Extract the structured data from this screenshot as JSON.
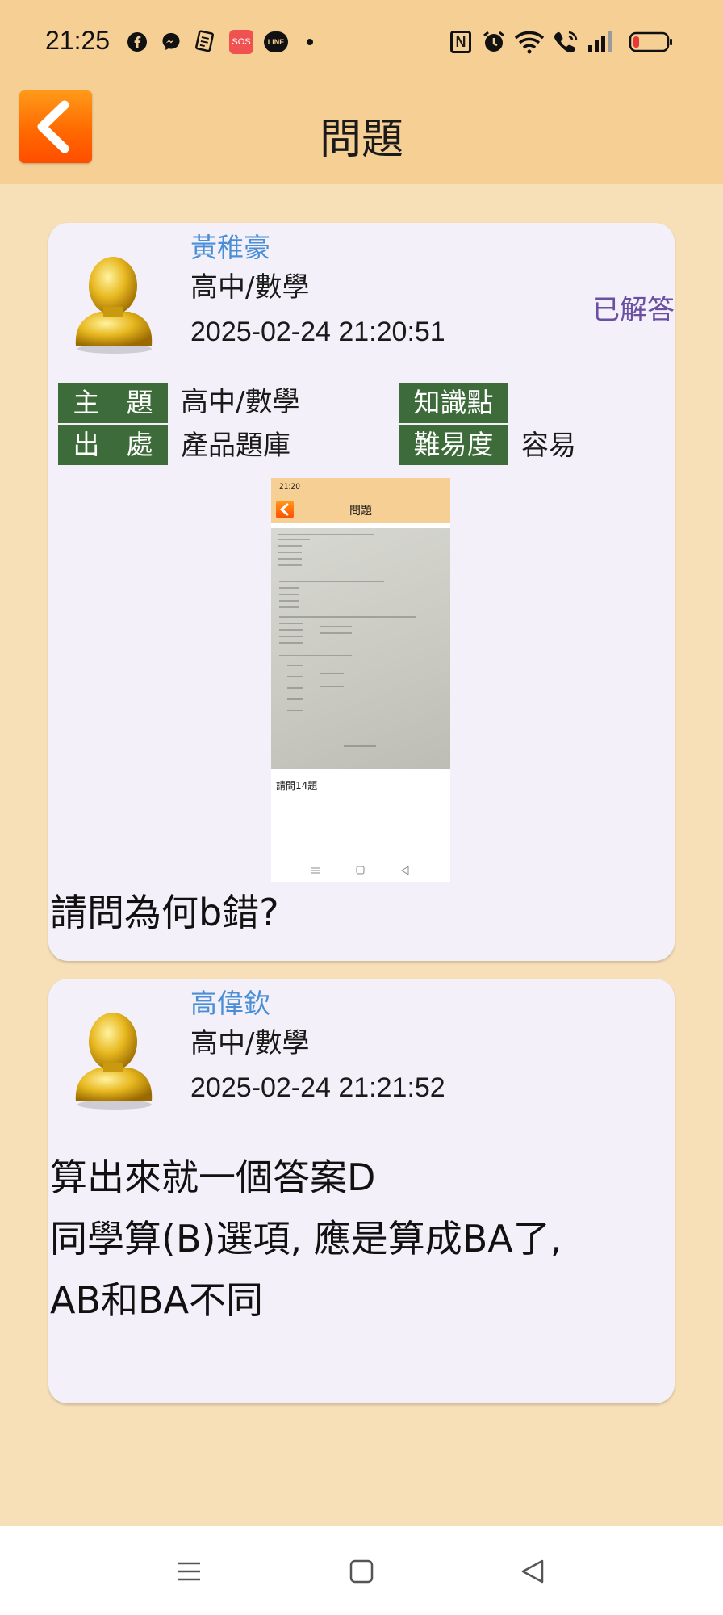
{
  "status_bar": {
    "time": "21:25",
    "icons": [
      "facebook-icon",
      "messenger-icon",
      "notes-app-icon",
      "sos-icon",
      "line-icon",
      "dot-icon",
      "nfc-icon",
      "alarm-icon",
      "wifi-icon",
      "wifi-call-icon",
      "signal-icon",
      "battery-low-icon"
    ],
    "sos_label": "SOS",
    "line_label": "LINE",
    "nfc_label": "N"
  },
  "header": {
    "title": "問題",
    "back_icon": "chevron-left-icon"
  },
  "question": {
    "user_name": "黃稚豪",
    "category": "高中/數學",
    "timestamp": "2025-02-24 21:20:51",
    "status": "已解答",
    "fields": {
      "topic_label": "主　題",
      "topic_value": "高中/數學",
      "knowledge_label": "知識點",
      "knowledge_value": "",
      "source_label": "出　處",
      "source_value": "產品題庫",
      "difficulty_label": "難易度",
      "difficulty_value": "容易"
    },
    "attachment": {
      "title": "問題",
      "time": "21:20",
      "caption": "請問14題"
    },
    "text": "請問為何b錯?"
  },
  "answer": {
    "user_name": "高偉欽",
    "category": "高中/數學",
    "timestamp": "2025-02-24 21:21:52",
    "text": "算出來就一個答案D\n同學算(B)選項, 應是算成BA了,\nAB和BA不同"
  },
  "nav_bar": {
    "icons": [
      "menu-icon",
      "home-square-icon",
      "back-triangle-icon"
    ]
  },
  "colors": {
    "header_bg": "#f5cf94",
    "page_bg": "#f7e0b8",
    "card_bg": "#f3f0f9",
    "tag_bg": "#3e6b3a",
    "name_blue": "#4a8fd6",
    "status_purple": "#6a4fa2",
    "back_orange": "#ff6a00"
  }
}
